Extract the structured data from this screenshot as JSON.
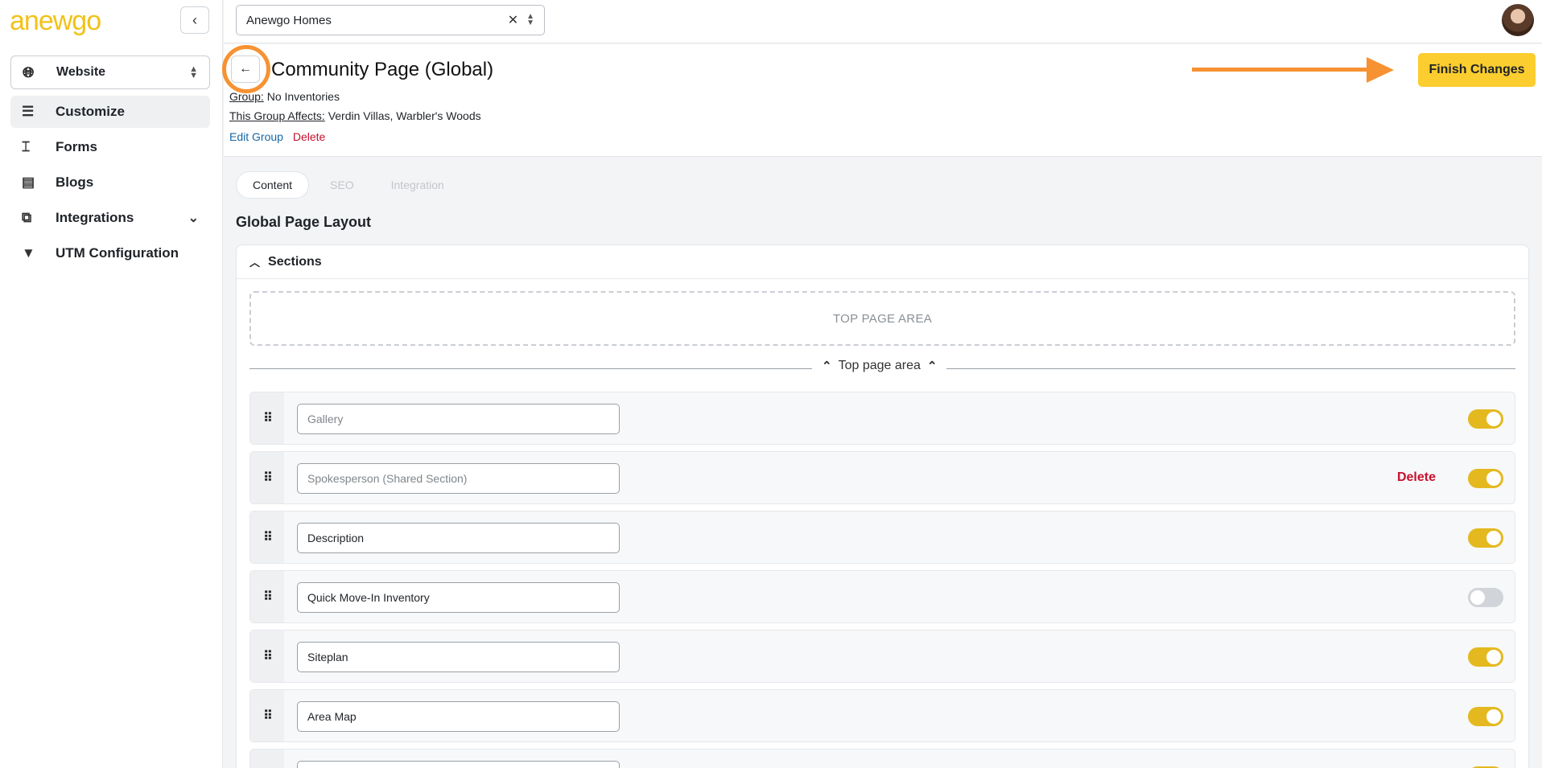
{
  "app": {
    "logo_text_a": "a",
    "logo_text_rest": "newgo",
    "brand_color": "#f2c218"
  },
  "sidebar": {
    "site_select": "Website",
    "items": [
      {
        "label": "Customize",
        "icon": "customize-icon",
        "active": true
      },
      {
        "label": "Forms",
        "icon": "forms-icon"
      },
      {
        "label": "Blogs",
        "icon": "blogs-icon"
      },
      {
        "label": "Integrations",
        "icon": "integrations-icon",
        "has_children": true
      },
      {
        "label": "UTM Configuration",
        "icon": "utm-icon"
      }
    ]
  },
  "topbar": {
    "org_select": "Anewgo Homes"
  },
  "header": {
    "title": "Community Page (Global)",
    "group_key": "Group:",
    "group_value": "No Inventories",
    "affects_key": "This Group Affects:",
    "affects_value": "Verdin Villas, Warbler's Woods",
    "edit_label": "Edit Group",
    "delete_label": "Delete",
    "finish_label": "Finish Changes",
    "highlight_color": "#f79232"
  },
  "tabs": [
    {
      "label": "Content",
      "active": true
    },
    {
      "label": "SEO"
    },
    {
      "label": "Integration"
    }
  ],
  "layout": {
    "heading": "Global Page Layout",
    "card_title": "Sections",
    "top_area": "TOP PAGE AREA",
    "divider_label": "Top page area",
    "rows": [
      {
        "placeholder": "Gallery",
        "value": "",
        "enabled": true,
        "delete": ""
      },
      {
        "placeholder": "Spokesperson (Shared Section)",
        "value": "",
        "enabled": true,
        "delete": "Delete"
      },
      {
        "placeholder": "",
        "value": "Description",
        "enabled": true,
        "delete": ""
      },
      {
        "placeholder": "",
        "value": "Quick Move-In Inventory",
        "enabled": false,
        "delete": ""
      },
      {
        "placeholder": "",
        "value": "Siteplan",
        "enabled": true,
        "delete": ""
      },
      {
        "placeholder": "",
        "value": "Area Map",
        "enabled": true,
        "delete": ""
      }
    ]
  }
}
